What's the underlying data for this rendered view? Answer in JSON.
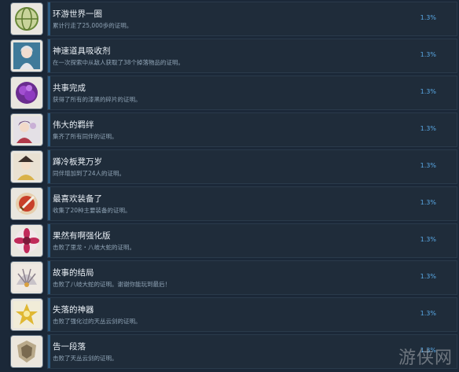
{
  "achievements": [
    {
      "title": "环游世界一圈",
      "description": "累计行走了25,000歩的证明。",
      "percent": "1.3%",
      "icon": "world-globe-icon"
    },
    {
      "title": "神速道具吸收剂",
      "description": "在一次探索中从敌人获取了38个掉落物品的证明。",
      "percent": "1.3%",
      "icon": "character-portrait-icon"
    },
    {
      "title": "共事完成",
      "description": "获得了所有的漆黑的碎片的证明。",
      "percent": "1.3%",
      "icon": "purple-shards-icon"
    },
    {
      "title": "伟大的羁绊",
      "description": "集齐了所有同伴的证明。",
      "percent": "1.3%",
      "icon": "companions-icon"
    },
    {
      "title": "蹲冷板凳万岁",
      "description": "同伴增加到了24人的证明。",
      "percent": "1.3%",
      "icon": "bench-character-icon"
    },
    {
      "title": "最喜欢装备了",
      "description": "收集了20种主要装备的证明。",
      "percent": "1.3%",
      "icon": "sword-icon"
    },
    {
      "title": "果然有啊强化版",
      "description": "击败了里龙・八岐大蛇的证明。",
      "percent": "1.3%",
      "icon": "flower-burst-icon"
    },
    {
      "title": "故事的结局",
      "description": "击败了八岐大蛇的证明。谢谢你能玩到最后！",
      "percent": "1.3%",
      "icon": "fan-emblem-icon"
    },
    {
      "title": "失落的神器",
      "description": "击败了强化过的天丛云剑的证明。",
      "percent": "1.3%",
      "icon": "golden-artifact-icon"
    },
    {
      "title": "告一段落",
      "description": "击败了天丛云剑的证明。",
      "percent": "1.3%",
      "icon": "crest-icon"
    }
  ],
  "watermark": "游侠网"
}
